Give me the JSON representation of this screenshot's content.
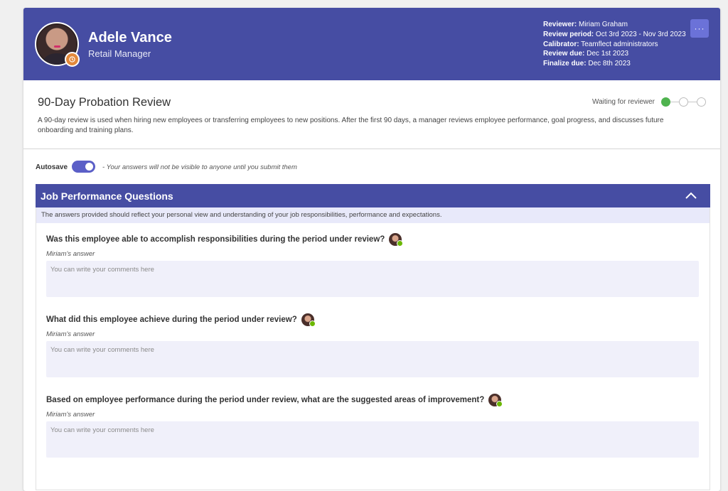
{
  "header": {
    "user_name": "Adele Vance",
    "user_role": "Retail Manager",
    "reviewer_label": "Reviewer:",
    "reviewer_value": "Miriam Graham",
    "period_label": "Review period:",
    "period_value": "Oct 3rd 2023 - Nov 3rd 2023",
    "calibrator_label": "Calibrator:",
    "calibrator_value": "Teamflect administrators",
    "review_due_label": "Review due:",
    "review_due_value": "Dec 1st 2023",
    "finalize_due_label": "Finalize due:",
    "finalize_due_value": "Dec 8th 2023",
    "more_label": "···"
  },
  "review": {
    "title": "90-Day Probation Review",
    "status": "Waiting for reviewer",
    "description": "A 90-day review is used when hiring new employees or transferring employees to new positions. After the first 90 days, a manager reviews employee performance, goal progress, and discusses future onboarding and training plans."
  },
  "autosave": {
    "label": "Autosave",
    "enabled": true,
    "note": "- Your answers will not be visible to anyone until you submit them"
  },
  "section": {
    "title": "Job Performance Questions",
    "subtitle": "The answers provided should reflect your personal view and understanding of your job responsibilities, performance and expectations.",
    "questions": [
      {
        "text": "Was this employee able to accomplish responsibilities during the period under review?",
        "answer_label": "Miriam's answer",
        "placeholder": "You can write your comments here"
      },
      {
        "text": "What did this employee achieve during the period under review?",
        "answer_label": "Miriam's answer",
        "placeholder": "You can write your comments here"
      },
      {
        "text": "Based on employee performance during the period under review, what are the suggested areas of improvement?",
        "answer_label": "Miriam's answer",
        "placeholder": "You can write your comments here"
      }
    ]
  },
  "colors": {
    "brand": "#464da3",
    "accent": "#5b5fc7",
    "status_active": "#4fb34f",
    "online": "#6bb700"
  }
}
